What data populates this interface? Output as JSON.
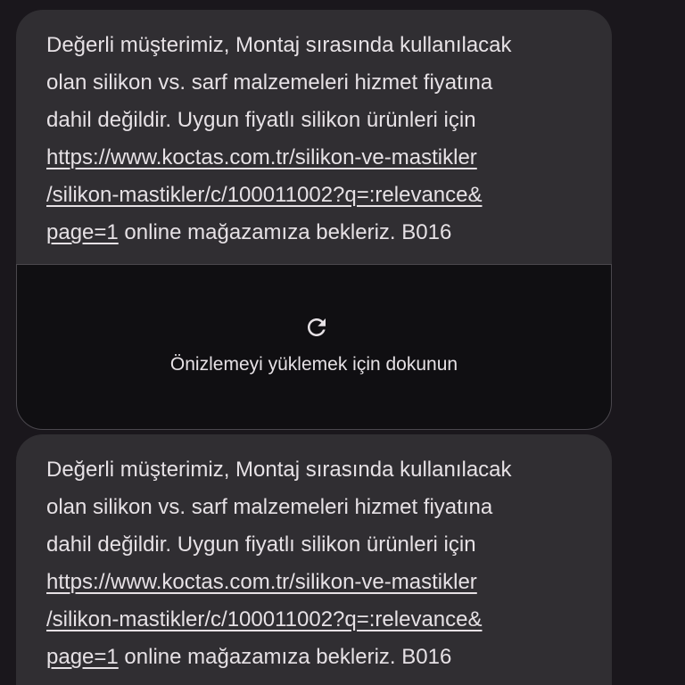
{
  "messages": [
    {
      "lines": [
        "Değerli müşterimiz, Montaj sırasında kullanılacak",
        "olan silikon vs. sarf malzemeleri hizmet fiyatına",
        "dahil değildir. Uygun fiyatlı silikon ürünleri için"
      ],
      "link_lines": [
        "https://www.koctas.com.tr/silikon-ve-mastikler",
        "/silikon-mastikler/c/100011002?q=:relevance&",
        "page=1"
      ],
      "tail_text": " online mağazamıza bekleriz. B016"
    },
    {
      "lines": [
        "Değerli müşterimiz, Montaj sırasında kullanılacak",
        "olan silikon vs. sarf malzemeleri hizmet fiyatına",
        "dahil değildir. Uygun fiyatlı silikon ürünleri için"
      ],
      "link_lines": [
        "https://www.koctas.com.tr/silikon-ve-mastikler",
        "/silikon-mastikler/c/100011002?q=:relevance&",
        "page=1"
      ],
      "tail_text": " online mağazamıza bekleriz. B016"
    }
  ],
  "link_preview": {
    "icon": "refresh-icon",
    "label": "Önizlemeyi yüklemek için dokunun"
  },
  "colors": {
    "background": "#1a171c",
    "bubble": "#302e32",
    "preview_background": "#100f12",
    "text": "#e6e1e5"
  }
}
